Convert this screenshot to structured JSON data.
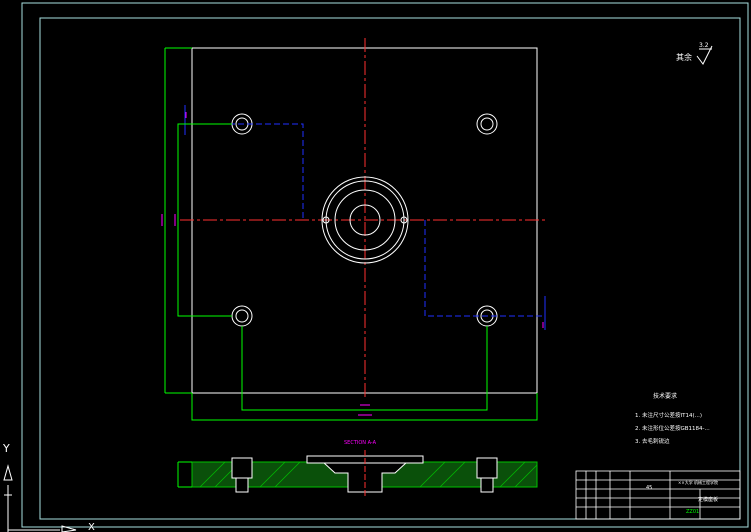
{
  "surface_note": "其余",
  "roughness_value": "3.2",
  "tech_requirements": {
    "title": "技术要求",
    "items": [
      "1. 未注尺寸公差按IT14(...)",
      "2. 未注形位公差按GB1184-...",
      "3. 去毛刺锐边"
    ]
  },
  "section_label": "SECTION A-A",
  "title_block": {
    "material": "45",
    "company": "××大学 机械工程学院",
    "drawing_name": "定模座板",
    "drawing_no": "ZZ01"
  },
  "colors": {
    "outline": "#ffffff",
    "frame": "#a8e0e0",
    "center_line": "#ff3030",
    "hidden_line": "#2030ff",
    "dimension": "#00ff00",
    "dim_text": "#ff00ff",
    "hatch": "#00c000",
    "note_text": "#ffffff"
  }
}
